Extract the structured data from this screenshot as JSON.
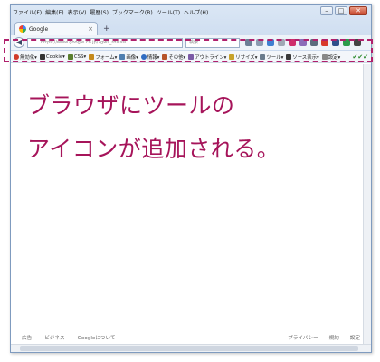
{
  "menubar": [
    "ファイル(F)",
    "編集(E)",
    "表示(V)",
    "履歴(S)",
    "ブックマーク(B)",
    "ツール(T)",
    "ヘルプ(H)"
  ],
  "window_controls": {
    "minimize": "–",
    "maximize": "□",
    "close": "✕"
  },
  "tab": {
    "title": "Google",
    "close": "×",
    "new_tab": "+"
  },
  "navbar": {
    "back": "◀",
    "url": "https://www.google.co.jp/?gws_rd=ssl",
    "search_placeholder": "検索"
  },
  "devbar": {
    "items": [
      {
        "label": "無効化▾",
        "color": "#d23b2a"
      },
      {
        "label": "Cookie▾",
        "color": "#333333"
      },
      {
        "label": "CSS▾",
        "color": "#5a7f2f"
      },
      {
        "label": "フォーム▾",
        "color": "#c58a1c"
      },
      {
        "label": "画像▾",
        "color": "#4f7fb0"
      },
      {
        "label": "情報▾",
        "color": "#2f6cc2"
      },
      {
        "label": "その他▾",
        "color": "#b7542a"
      },
      {
        "label": "アウトライン▾",
        "color": "#7b5aa6"
      },
      {
        "label": "リサイズ▾",
        "color": "#c7a22a"
      },
      {
        "label": "ツール▾",
        "color": "#6a7b8c"
      },
      {
        "label": "ソース表示▾",
        "color": "#3a3a3a"
      },
      {
        "label": "設定▾",
        "color": "#888888"
      }
    ],
    "checks": "✔✔✔"
  },
  "caption": {
    "line1": "ブラウザにツールの",
    "line2": "アイコンが追加される。"
  },
  "footer": {
    "left": [
      "広告",
      "ビジネス",
      "Googleについて"
    ],
    "right": [
      "プライバシー",
      "規約",
      "設定"
    ]
  },
  "colors": {
    "accent": "#a6145a",
    "highlight": "#b0206c"
  }
}
